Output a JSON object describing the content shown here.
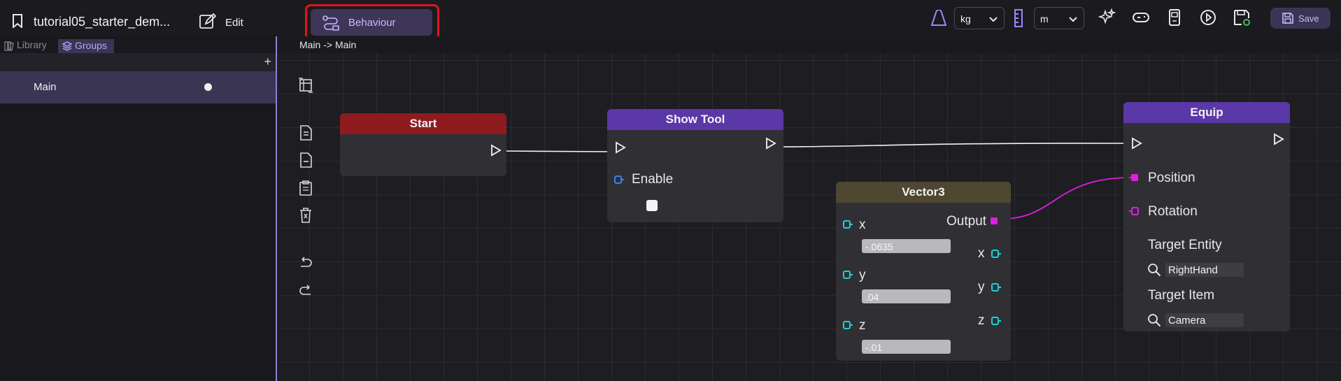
{
  "topbar": {
    "title": "tutorial05_starter_dem...",
    "edit_label": "Edit",
    "behaviour_label": "Behaviour",
    "mass_unit": "kg",
    "length_unit": "m",
    "save_label": "Save",
    "accent": "#c9b8ff",
    "highlight": "#e0141e"
  },
  "sidebar": {
    "tabs": [
      {
        "label": "Library"
      },
      {
        "label": "Groups"
      }
    ],
    "add": "+",
    "items": [
      {
        "label": "Main"
      }
    ]
  },
  "canvas": {
    "breadcrumb": "Main -> Main",
    "nodes": {
      "start": {
        "title": "Start",
        "color": "#8f1b1f"
      },
      "show_tool": {
        "title": "Show Tool",
        "color": "#5a38a8",
        "enable_label": "Enable"
      },
      "vector3": {
        "title": "Vector3",
        "color": "#4e4731",
        "output_label": "Output",
        "x_label": "x",
        "y_label": "y",
        "z_label": "z",
        "x_value": "-.0635",
        "y_value": ".04",
        "z_value": "-.01"
      },
      "equip": {
        "title": "Equip",
        "color": "#5a38a8",
        "position_label": "Position",
        "rotation_label": "Rotation",
        "target_entity_label": "Target Entity",
        "target_entity_value": "RightHand",
        "target_item_label": "Target Item",
        "target_item_value": "Camera"
      }
    }
  }
}
